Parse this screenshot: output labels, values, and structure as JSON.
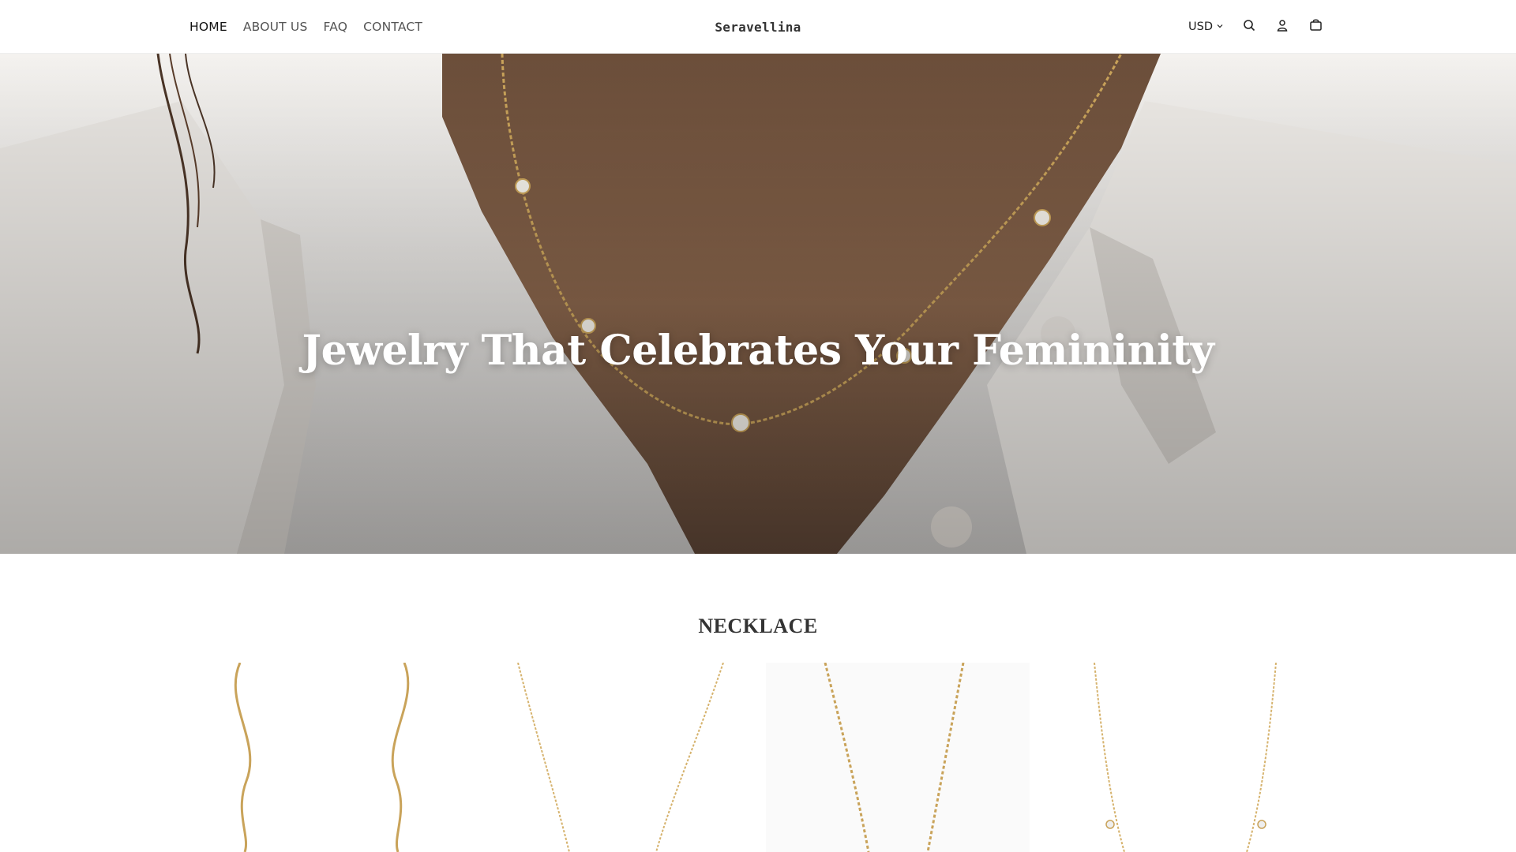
{
  "header": {
    "nav": [
      "HOME",
      "ABOUT US",
      "FAQ",
      "CONTACT"
    ],
    "logo": "Seravellina",
    "currency": "USD"
  },
  "hero": {
    "title": "Jewelry That Celebrates Your Femininity"
  },
  "section": {
    "title": "NECKLACE"
  },
  "icons": {
    "currency_caret": "chevron-down-icon",
    "search": "search-icon",
    "account": "user-icon",
    "cart": "bag-icon"
  },
  "colors": {
    "gold": "#c9a35a",
    "text": "#222222"
  }
}
